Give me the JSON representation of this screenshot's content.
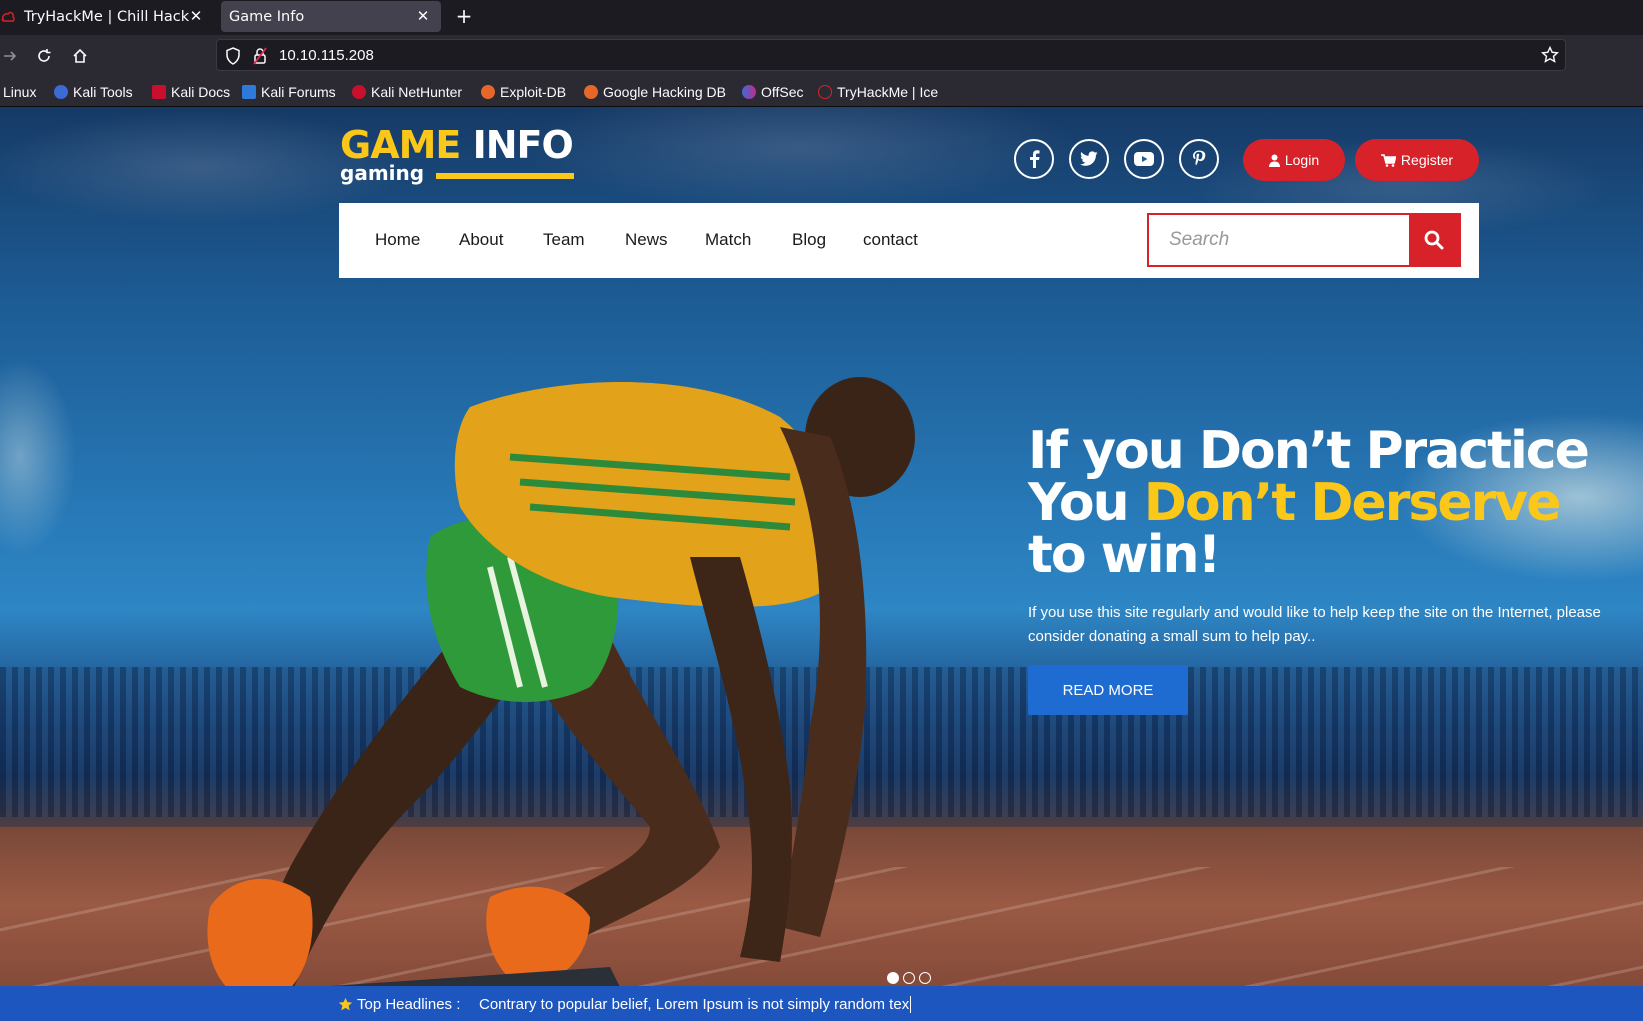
{
  "browser": {
    "tabs": [
      {
        "title": "TryHackMe | Chill Hack",
        "active": false
      },
      {
        "title": "Game Info",
        "active": true
      }
    ],
    "url": "10.10.115.208",
    "bookmarks": [
      "i Linux",
      "Kali Tools",
      "Kali Docs",
      "Kali Forums",
      "Kali NetHunter",
      "Exploit-DB",
      "Google Hacking DB",
      "OffSec",
      "TryHackMe | Ice"
    ]
  },
  "site": {
    "logo": {
      "word1": "GAME",
      "word2": "INFO",
      "tagline": "gaming"
    },
    "social": [
      "facebook-icon",
      "twitter-icon",
      "youtube-icon",
      "pinterest-icon"
    ],
    "login_label": "Login",
    "register_label": "Register",
    "nav": [
      "Home",
      "About",
      "Team",
      "News",
      "Match",
      "Blog",
      "contact"
    ],
    "search_placeholder": "Search",
    "hero": {
      "line1": "If you Don’t Practice",
      "line2_white": "You ",
      "line2_yellow": "Don’t Derserve",
      "line3": "to win!",
      "body": "If you use this site regularly and would like to help keep the site on the Internet, please consider donating a small sum to help pay..",
      "cta": "READ MORE"
    },
    "slider_dots": 3,
    "slider_active": 1,
    "ticker": {
      "label": "Top Headlines :",
      "text": "Contrary to popular belief, Lorem Ipsum is not simply random tex"
    },
    "colors": {
      "accent_yellow": "#fbc719",
      "accent_red": "#d8222a",
      "cta_blue": "#1e6bd2",
      "ticker_blue": "#1e56c0"
    }
  }
}
